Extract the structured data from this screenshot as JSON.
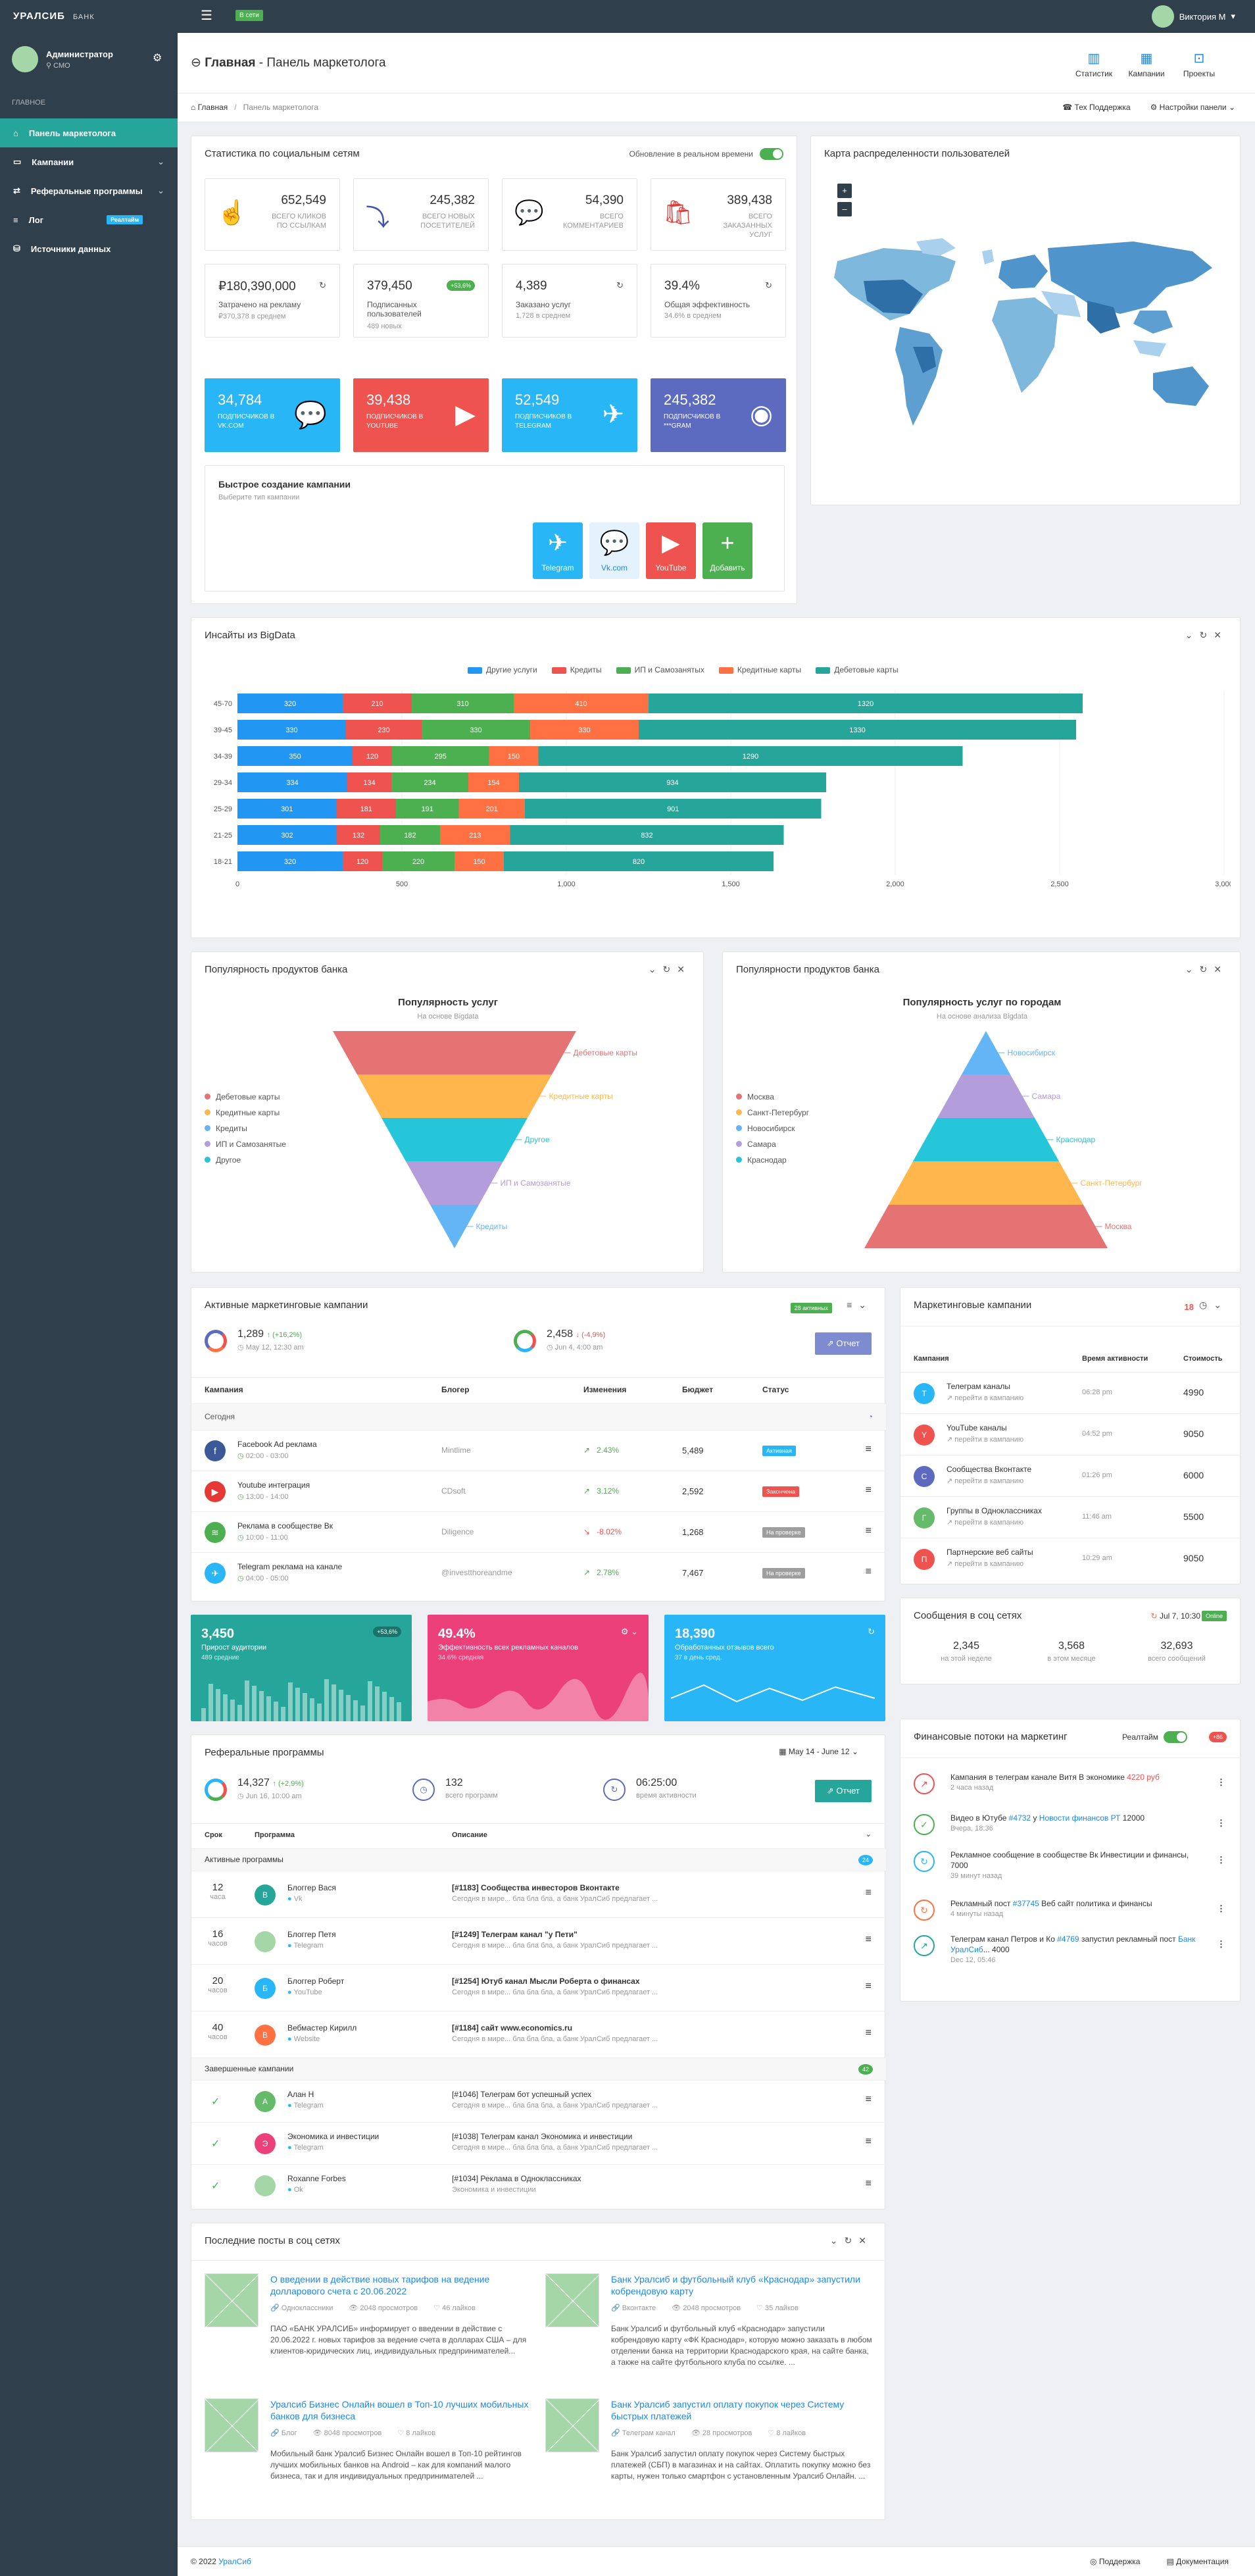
{
  "app": {
    "logo": "УРАЛСИБ",
    "logo_sub": "БАНК",
    "online": "В сети",
    "user": "Виктория М"
  },
  "sidebar": {
    "name": "Администратор",
    "role": "СМО",
    "section": "Главное",
    "items": [
      {
        "label": "Панель маркетолога",
        "icon": "home-icon"
      },
      {
        "label": "Кампании",
        "icon": "folder-icon"
      },
      {
        "label": "Реферальные программы",
        "icon": "share-icon"
      },
      {
        "label": "Лог",
        "icon": "list-icon",
        "badge": "Реалтайм"
      },
      {
        "label": "Источники данных",
        "icon": "database-icon"
      }
    ]
  },
  "header": {
    "title_a": "Главная",
    "title_b": "Панель маркетолога",
    "actions": [
      "Статистик",
      "Кампании",
      "Проекты"
    ]
  },
  "breadcrumb": {
    "home": "Главная",
    "current": "Панель маркетолога",
    "support": "Тех Поддержка",
    "settings": "Настройки панели"
  },
  "social": {
    "title": "Статистика по социальным сетям",
    "realtime": "Обновление в реальном времени",
    "stats1": [
      {
        "v": "652,549",
        "l": "Всего кликов по ссылкам",
        "color": "#26a69a",
        "icon": "pointer-icon"
      },
      {
        "v": "245,382",
        "l": "Всего новых посетителей",
        "color": "#3f51b5",
        "icon": "arrow-in-icon"
      },
      {
        "v": "54,390",
        "l": "Всего комментариев",
        "color": "#29b6f6",
        "icon": "comments-icon"
      },
      {
        "v": "389,438",
        "l": "Всего заказанных услуг",
        "color": "#e53935",
        "icon": "bag-icon"
      }
    ],
    "stats2": [
      {
        "v": "₽180,390,000",
        "l": "Затрачено на рекламу",
        "s": "₽370,378 в среднем"
      },
      {
        "v": "379,450",
        "l": "Подписанных пользователей",
        "s": "489 новых",
        "badge": "+53,6%"
      },
      {
        "v": "4,389",
        "l": "Заказано услуг",
        "s": "1,728 в среднем"
      },
      {
        "v": "39.4%",
        "l": "Общая эффективность",
        "s": "34.6% в среднем"
      }
    ],
    "tiles": [
      {
        "v": "34,784",
        "l": "подписчиков в VK.COM",
        "color": "#29b6f6",
        "icon": "vk-icon"
      },
      {
        "v": "39,438",
        "l": "подписчиков в Youtube",
        "color": "#ef5350",
        "icon": "youtube-icon"
      },
      {
        "v": "52,549",
        "l": "подписчиков в Telegram",
        "color": "#29b6f6",
        "icon": "telegram-icon"
      },
      {
        "v": "245,382",
        "l": "подписчиков в ***gram",
        "color": "#5c6bc0",
        "icon": "instagram-icon"
      }
    ],
    "quick_title": "Быстрое создание кампании",
    "quick_sub": "Выберите тип кампании",
    "quick": [
      {
        "label": "Telegram",
        "color": "#29b6f6",
        "icon": "telegram-icon"
      },
      {
        "label": "Vk.com",
        "color": "#e3f2fd",
        "icon": "vk-icon"
      },
      {
        "label": "YouTube",
        "color": "#ef5350",
        "icon": "youtube-icon"
      },
      {
        "label": "Добавить",
        "color": "#4caf50",
        "icon": "plus-icon"
      }
    ]
  },
  "map": {
    "title": "Карта распределенности пользователей",
    "zoom_in": "+",
    "zoom_out": "–"
  },
  "bigdata": {
    "title": "Инсайты из BigData",
    "chart_data": {
      "type": "bar",
      "stacked": true,
      "orientation": "horizontal",
      "categories": [
        "45-70",
        "39-45",
        "34-39",
        "29-34",
        "25-29",
        "21-25",
        "18-21"
      ],
      "series": [
        {
          "name": "Другие услуги",
          "color": "#2196f3",
          "values": [
            320,
            330,
            350,
            334,
            301,
            302,
            320
          ]
        },
        {
          "name": "Кредиты",
          "color": "#ef5350",
          "values": [
            210,
            230,
            120,
            134,
            181,
            132,
            120
          ]
        },
        {
          "name": "ИП и Самозанятых",
          "color": "#4caf50",
          "values": [
            310,
            330,
            295,
            234,
            191,
            182,
            220
          ]
        },
        {
          "name": "Кредитные карты",
          "color": "#ff7043",
          "values": [
            410,
            330,
            150,
            154,
            201,
            213,
            150
          ]
        },
        {
          "name": "Дебетовые карты",
          "color": "#26a69a",
          "values": [
            1320,
            1330,
            1290,
            934,
            901,
            832,
            820
          ]
        }
      ],
      "xlim": [
        0,
        3000
      ],
      "xticks": [
        "0",
        "500",
        "1,000",
        "1,500",
        "2,000",
        "2,500",
        "3,000"
      ],
      "legend": "top"
    }
  },
  "funnel1": {
    "title": "Популярность продуктов банка",
    "chart_title": "Популярность услуг",
    "chart_sub": "На основе Bigdata",
    "chart_data": {
      "type": "funnel",
      "labels": [
        "Дебетовые карты",
        "Кредитные карты",
        "Другое",
        "ИП и Самозанятые",
        "Кредиты"
      ],
      "colors": [
        "#e57373",
        "#ffb74d",
        "#26c6da",
        "#b39ddb",
        "#64b5f6"
      ],
      "legend": [
        {
          "l": "Дебетовые карты",
          "c": "#e57373"
        },
        {
          "l": "Кредитные карты",
          "c": "#ffb74d"
        },
        {
          "l": "Кредиты",
          "c": "#64b5f6"
        },
        {
          "l": "ИП и Самозанятые",
          "c": "#b39ddb"
        },
        {
          "l": "Другое",
          "c": "#26c6da"
        }
      ]
    }
  },
  "funnel2": {
    "title": "Популярности продуктов банка",
    "chart_title": "Популярность услуг по городам",
    "chart_sub": "На основе анализа Bigdata",
    "chart_data": {
      "type": "pyramid",
      "labels": [
        "Новосибирск",
        "Самара",
        "Краснодар",
        "Санкт-Петербург",
        "Москва"
      ],
      "colors": [
        "#64b5f6",
        "#b39ddb",
        "#26c6da",
        "#ffb74d",
        "#e57373"
      ],
      "legend": [
        {
          "l": "Москва",
          "c": "#e57373"
        },
        {
          "l": "Санкт-Петербург",
          "c": "#ffb74d"
        },
        {
          "l": "Новосибирск",
          "c": "#64b5f6"
        },
        {
          "l": "Самара",
          "c": "#b39ddb"
        },
        {
          "l": "Краснодар",
          "c": "#26c6da"
        }
      ]
    }
  },
  "active": {
    "title": "Активные маркетинговые кампании",
    "badge": "28 активных",
    "k1": "1,289",
    "k1c": "(+16,2%)",
    "k1d": "May 12, 12:30 am",
    "k2": "2,458",
    "k2c": "(-4,9%)",
    "k2d": "Jun 4, 4:00 am",
    "report": "Отчет",
    "cols": [
      "Кампания",
      "Блогер",
      "Изменения",
      "Бюджет",
      "Статус"
    ],
    "group": "Сегодня",
    "rows": [
      {
        "n": "Facebook Ad реклама",
        "t": "02:00 - 03:00",
        "b": "Mintlime",
        "c": "2.43%",
        "up": true,
        "bu": "5,489",
        "s": "Активная",
        "sc": "#29b6f6",
        "ic": "#3b5998",
        "ico": "f"
      },
      {
        "n": "Youtube интеграция",
        "t": "13:00 - 14:00",
        "b": "CDsoft",
        "c": "3.12%",
        "up": true,
        "bu": "2,592",
        "s": "Закончена",
        "sc": "#ef5350",
        "ic": "#e53935",
        "ico": "▶"
      },
      {
        "n": "Реклама в сообществе Вк",
        "t": "10:00 - 11:00",
        "b": "Diligence",
        "c": "-8.02%",
        "up": false,
        "bu": "1,268",
        "s": "На проверке",
        "sc": "#9e9e9e",
        "ic": "#4caf50",
        "ico": "≋"
      },
      {
        "n": "Telegram реклама на канале",
        "t": "04:00 - 05:00",
        "b": "@investthoreandme",
        "c": "2.78%",
        "up": true,
        "bu": "7,467",
        "s": "На проверке",
        "sc": "#9e9e9e",
        "ic": "#29b6f6",
        "ico": "✈"
      }
    ]
  },
  "mcamp": {
    "title": "Маркетинговые кампании",
    "count": "18",
    "cols": [
      "Кампания",
      "Время активности",
      "Стоимость"
    ],
    "rows": [
      {
        "n": "Телеграм каналы",
        "s": "перейти в кампанию",
        "t": "06:28 pm",
        "v": "4990",
        "c": "#29b6f6",
        "l": "T"
      },
      {
        "n": "YouTube каналы",
        "s": "перейти в кампанию",
        "t": "04:52 pm",
        "v": "9050",
        "c": "#ef5350",
        "l": "Y"
      },
      {
        "n": "Сообщества Вконтакте",
        "s": "перейти в кампанию",
        "t": "01:26 pm",
        "v": "6000",
        "c": "#5c6bc0",
        "l": "C"
      },
      {
        "n": "Группы в Одноклассниках",
        "s": "перейти в кампанию",
        "t": "11:46 am",
        "v": "5500",
        "c": "#66bb6a",
        "l": "Г"
      },
      {
        "n": "Партнерские веб сайты",
        "s": "перейти в кампанию",
        "t": "10:29 am",
        "v": "9050",
        "c": "#ef5350",
        "l": "П"
      }
    ]
  },
  "smsg": {
    "title": "Сообщения в соц сетях",
    "date": "Jul 7, 10:30",
    "status": "Online",
    "s": [
      {
        "v": "2,345",
        "l": "на этой неделе"
      },
      {
        "v": "3,568",
        "l": "в этом месяце"
      },
      {
        "v": "32,693",
        "l": "всего сообщений"
      }
    ]
  },
  "ctiles": [
    {
      "v": "3,450",
      "l": "Прирост аудитории",
      "s": "489 средние",
      "badge": "+53,6%",
      "color": "#26a69a"
    },
    {
      "v": "49.4%",
      "l": "Эффективность всех рекламных каналов",
      "s": "34.6% средняя",
      "color": "#ec407a"
    },
    {
      "v": "18,390",
      "l": "Обработанных отзывов всего",
      "s": "37 в день сред.",
      "color": "#29b6f6"
    }
  ],
  "ref": {
    "title": "Реферальные программы",
    "range": "May 14 - June 12",
    "k1": "14,327",
    "k1c": "(+2,9%)",
    "k1d": "Jun 16, 10:00 am",
    "k2": "132",
    "k2l": "всего программ",
    "k3": "06:25:00",
    "k3l": "время активности",
    "report": "Отчет",
    "cols": [
      "Срок",
      "Программа",
      "Описание"
    ],
    "g1": "Активные программы",
    "g1c": "24",
    "rows": [
      {
        "d": "12",
        "u": "часа",
        "n": "Блоггер Вася",
        "p": "Vk",
        "t": "[#1183] Сообщества инвесторов Вконтакте",
        "s": "Сегодня в мире... бла бла бла, а банк УралСиб предлагает ...",
        "c": "#26a69a",
        "l": "В"
      },
      {
        "d": "16",
        "u": "часов",
        "n": "Блоггер Петя",
        "p": "Telegram",
        "t": "[#1249] Телеграм канал \"у Пети\"",
        "s": "Сегодня в мире... бла бла бла, а банк УралСиб предлагает ...",
        "c": "#a5d6a7",
        "l": ""
      },
      {
        "d": "20",
        "u": "часов",
        "n": "Блоггер Роберт",
        "p": "YouTube",
        "t": "[#1254] Ютуб канал Мысли Роберта о финансах",
        "s": "Сегодня в мире... бла бла бла, а банк УралСиб предлагает ...",
        "c": "#29b6f6",
        "l": "Б"
      },
      {
        "d": "40",
        "u": "часов",
        "n": "Вебмастер Кирилл",
        "p": "Website",
        "t": "[#1184] сайт www.economics.ru",
        "s": "Сегодня в мире... бла бла бла, а банк УралСиб предлагает ...",
        "c": "#ff7043",
        "l": "В"
      }
    ],
    "g2": "Завершенные кампании",
    "g2c": "42",
    "done": [
      {
        "n": "Алан Н",
        "p": "Telegram",
        "t": "[#1046] Телеграм бот успешный успех",
        "s": "Сегодня в мире... бла бла бла, а банк УралСиб предлагает ...",
        "c": "#66bb6a",
        "l": "А"
      },
      {
        "n": "Экономика и инвестиции",
        "p": "Telegram",
        "t": "[#1038] Телеграм канал Экономика и инвестиции",
        "s": "Сегодня в мире... бла бла бла, а банк УралСиб предлагает ...",
        "c": "#ec407a",
        "l": "Э"
      },
      {
        "n": "Roxanne Forbes",
        "p": "Ok",
        "t": "[#1034] Реклама в Одноклассниках",
        "s": "Экономика и инвестиции",
        "c": "#a5d6a7",
        "l": ""
      }
    ]
  },
  "fin": {
    "title": "Финансовые потоки на маркетинг",
    "rt": "Реалтайм",
    "count": "+86",
    "items": [
      {
        "t": "Кампания в телеграм канале Витя В экономике ",
        "hl": "4220 руб",
        "hlc": "#ef5350",
        "s": "2 часа назад",
        "c": "#ef5350",
        "ic": "↗"
      },
      {
        "t": "Видео в Ютубе ",
        "hl": "#4732",
        "t2": " у ",
        "hl2": "Новости финансов РТ",
        "t3": " 12000",
        "s": "Вчера, 18:36",
        "c": "#4caf50",
        "ic": "✓"
      },
      {
        "t": "Рекламное сообщение в сообществе Вк Инвестиции и финансы, 7000",
        "s": "39 минут назад",
        "c": "#29b6f6",
        "ic": "↻"
      },
      {
        "t": "Рекламный пост ",
        "hl": "#37745",
        "t2": " Веб сайт политика и финансы",
        "s": "4 минуты назад",
        "c": "#ff7043",
        "ic": "↻"
      },
      {
        "t": "Телеграм канал Петров и Ко ",
        "hl": "#4769",
        "t2": " запустил рекламный пост ",
        "hl2": "Банк УралСиб",
        "t3": "... 4000",
        "s": "Dec 12, 05:46",
        "c": "#26a69a",
        "ic": "↗"
      }
    ]
  },
  "posts": {
    "title": "Последние посты в соц сетях",
    "items": [
      {
        "t": "О введении в действие новых тарифов на ведение долларового счета с 20.06.2022",
        "src": "Одноклассники",
        "views": "2048 просмотров",
        "likes": "46 лайков",
        "body": "ПАО «БАНК УРАЛСИБ» информирует о введении в действие с 20.06.2022 г. новых тарифов за ведение счета в долларах США – для клиентов-юридических лиц, индивидуальных предпринимателей..."
      },
      {
        "t": "Банк Уралсиб и футбольный клуб «Краснодар» запустили кобрендовую карту",
        "src": "Вконтакте",
        "views": "2048 просмотров",
        "likes": "35 лайков",
        "body": "Банк Уралсиб и футбольный клуб «Краснодар» запустили кобрендовую карту «ФК Краснодар», которую можно заказать в любом отделении банка на территории Краснодарского края, на сайте банка, а также на сайте футбольного клуба по ссылке. ..."
      },
      {
        "t": "Уралсиб Бизнес Онлайн вошел в Топ-10 лучших мобильных банков для бизнеса",
        "src": "Блог",
        "views": "8048 просмотров",
        "likes": "8 лайков",
        "body": "Мобильный банк Уралсиб Бизнес Онлайн вошел в Топ-10 рейтингов лучших мобильных банков на Android – как для компаний малого бизнеса, так и для индивидуальных предпринимателей ..."
      },
      {
        "t": "Банк Уралсиб запустил оплату покупок через Систему быстрых платежей",
        "src": "Телеграм канал",
        "views": "28 просмотров",
        "likes": "8 лайков",
        "body": "Банк Уралсиб запустил оплату покупок через Систему быстрых платежей (СБП) в магазинах и на сайтах. Оплатить покупку можно без карты, нужен только смартфон с установленным Уралсиб Онлайн. ..."
      }
    ]
  },
  "footer": {
    "copy": "© 2022 ",
    "brand": "УралСиб",
    "support": "Поддержка",
    "docs": "Документация"
  }
}
